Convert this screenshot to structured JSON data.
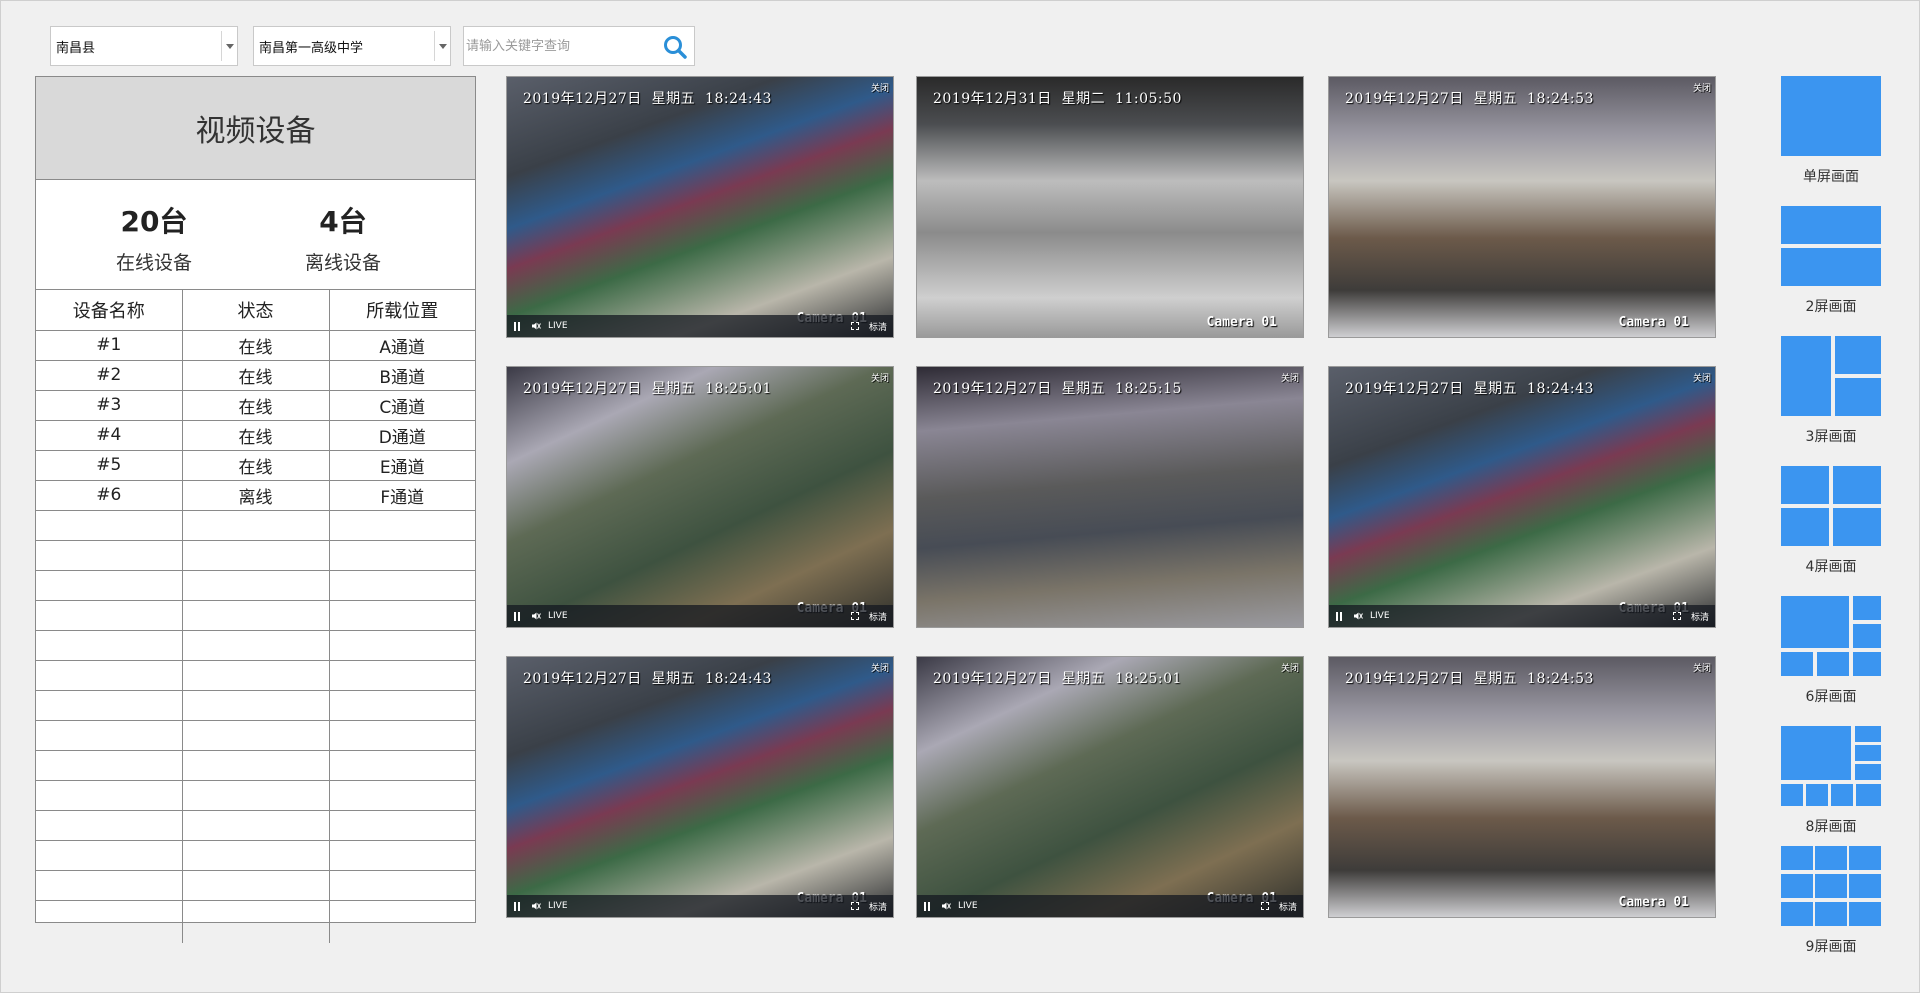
{
  "filters": {
    "county": "南昌县",
    "school": "南昌第一高级中学",
    "search_placeholder": "请输入关键字查询"
  },
  "panel": {
    "title": "视频设备",
    "online_count": "20台",
    "online_label": "在线设备",
    "offline_count": "4台",
    "offline_label": "离线设备",
    "columns": [
      "设备名称",
      "状态",
      "所载位置"
    ],
    "rows": [
      [
        "#1",
        "在线",
        "A通道"
      ],
      [
        "#2",
        "在线",
        "B通道"
      ],
      [
        "#3",
        "在线",
        "C通道"
      ],
      [
        "#4",
        "在线",
        "D通道"
      ],
      [
        "#5",
        "在线",
        "E通道"
      ],
      [
        "#6",
        "离线",
        "F通道"
      ]
    ]
  },
  "cameras": [
    {
      "timestamp": "2019年12月27日  星期五  18:24:43",
      "label": "Camera 01",
      "live": "LIVE",
      "quality": "标清",
      "close": "关闭"
    },
    {
      "timestamp": "2019年12月31日  星期二  11:05:50",
      "label": "Camera 01",
      "live": "",
      "quality": "",
      "close": ""
    },
    {
      "timestamp": "2019年12月27日  星期五  18:24:53",
      "label": "Camera 01",
      "live": "",
      "quality": "",
      "close": "关闭"
    },
    {
      "timestamp": "2019年12月27日  星期五  18:25:01",
      "label": "Camera 01",
      "live": "LIVE",
      "quality": "标清",
      "close": "关闭"
    },
    {
      "timestamp": "2019年12月27日  星期五  18:25:15",
      "label": "",
      "live": "",
      "quality": "",
      "close": "关闭"
    },
    {
      "timestamp": "2019年12月27日  星期五  18:24:43",
      "label": "Camera 01",
      "live": "LIVE",
      "quality": "标清",
      "close": "关闭"
    },
    {
      "timestamp": "2019年12月27日  星期五  18:24:43",
      "label": "Camera 01",
      "live": "LIVE",
      "quality": "标清",
      "close": "关闭"
    },
    {
      "timestamp": "2019年12月27日  星期五  18:25:01",
      "label": "Camera 01",
      "live": "LIVE",
      "quality": "标清",
      "close": "关闭"
    },
    {
      "timestamp": "2019年12月27日  星期五  18:24:53",
      "label": "Camera 01",
      "live": "",
      "quality": "",
      "close": "关闭"
    }
  ],
  "layouts": [
    {
      "label": "单屏画面",
      "icon": "single-screen-icon"
    },
    {
      "label": "2屏画面",
      "icon": "two-screen-icon"
    },
    {
      "label": "3屏画面",
      "icon": "three-screen-icon"
    },
    {
      "label": "4屏画面",
      "icon": "four-screen-icon"
    },
    {
      "label": "6屏画面",
      "icon": "six-screen-icon"
    },
    {
      "label": "8屏画面",
      "icon": "eight-screen-icon"
    },
    {
      "label": "9屏画面",
      "icon": "nine-screen-icon"
    }
  ],
  "colors": {
    "accent": "#3b95f0",
    "search_icon": "#2a8fd8",
    "panel_header": "#d9d9d9",
    "background": "#f0f0f0"
  }
}
